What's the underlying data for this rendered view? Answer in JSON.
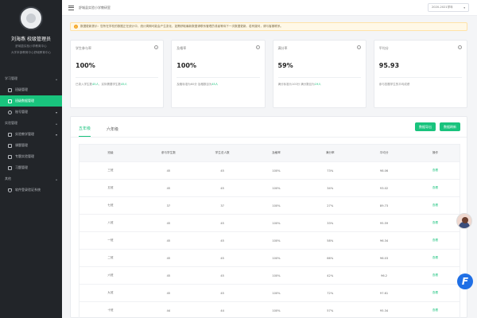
{
  "sidebar": {
    "profile_name": "刘海燕 校级管理员",
    "profile_sub1": "舒城县实验小学教育中心",
    "profile_sub2": "大学本部教育中心舒城教育中心",
    "groups": [
      {
        "label": "学习管理",
        "items": [
          {
            "label": "班级管理",
            "icon": "grid-icon",
            "active": false
          },
          {
            "label": "班级数据管理",
            "icon": "doc-icon",
            "active": true
          },
          {
            "label": "账号管理",
            "icon": "user-icon",
            "active": false
          }
        ]
      },
      {
        "label": "实验管理",
        "items": [
          {
            "label": "实验教学管理",
            "icon": "flask-icon",
            "active": false
          },
          {
            "label": "课题管理",
            "icon": "book-icon",
            "active": false
          },
          {
            "label": "专题实验管理",
            "icon": "folder-icon",
            "active": false
          },
          {
            "label": "习题管理",
            "icon": "list-icon",
            "active": false
          }
        ]
      },
      {
        "label": "其他",
        "items": [
          {
            "label": "软件登录验证系统",
            "icon": "shield-icon",
            "active": false
          }
        ]
      }
    ]
  },
  "topbar": {
    "breadcrumb": "舒城县实验小学教研室",
    "year": "2020-2021学年"
  },
  "notice": "数据更新提示：您所在学校的数据正在统计中，统计周期可能会产生变化，如需获取最新数据请联系管理员或者等待下一次数据更新。若有疑问，请与客服联系。",
  "cards": [
    {
      "title": "学生参与率",
      "value": "100%",
      "foot": "已录入学生数",
      "foot_hl": "45人",
      "foot2": "，实际需要学生数",
      "foot2_hl": "45人"
    },
    {
      "title": "及格率",
      "value": "100%",
      "foot": "及格标准为60分 及格数目为",
      "foot_hl": "45人",
      "foot2": "",
      "foot2_hl": ""
    },
    {
      "title": "满分率",
      "value": "59%",
      "foot": "满分标准为100分 满分数目为",
      "foot_hl": "19人",
      "foot2": "",
      "foot2_hl": ""
    },
    {
      "title": "平均分",
      "value": "95.93",
      "foot": "参与答题学生的平均成绩",
      "foot_hl": "",
      "foot2": "",
      "foot2_hl": ""
    }
  ],
  "panel": {
    "tabs": [
      {
        "label": "五年级",
        "active": true
      },
      {
        "label": "六年级",
        "active": false
      }
    ],
    "buttons": {
      "export": "数据导出",
      "refresh": "数据刷新"
    },
    "columns": [
      "班级",
      "参与学生数",
      "学生总人数",
      "及格率",
      "满分率",
      "平均分",
      "操作"
    ],
    "rows": [
      [
        "三班",
        "45",
        "45",
        "100%",
        "73%",
        "98.06",
        "查看"
      ],
      [
        "五班",
        "45",
        "45",
        "100%",
        "34%",
        "93.02",
        "查看"
      ],
      [
        "七班",
        "37",
        "37",
        "100%",
        "27%",
        "89.73",
        "查看"
      ],
      [
        "八班",
        "45",
        "45",
        "100%",
        "33%",
        "95.59",
        "查看"
      ],
      [
        "一班",
        "45",
        "45",
        "100%",
        "58%",
        "96.34",
        "查看"
      ],
      [
        "二班",
        "45",
        "45",
        "100%",
        "66%",
        "96.03",
        "查看"
      ],
      [
        "六班",
        "45",
        "45",
        "100%",
        "42%",
        "96.2",
        "查看"
      ],
      [
        "九班",
        "45",
        "45",
        "100%",
        "72%",
        "97.61",
        "查看"
      ],
      [
        "十班",
        "44",
        "44",
        "100%",
        "57%",
        "95.34",
        "查看"
      ]
    ]
  },
  "colors": {
    "accent": "#19c37d",
    "sidebar": "#222529",
    "float_brand": "#1f6fe5"
  },
  "floating": {
    "logo_letter": "F"
  }
}
